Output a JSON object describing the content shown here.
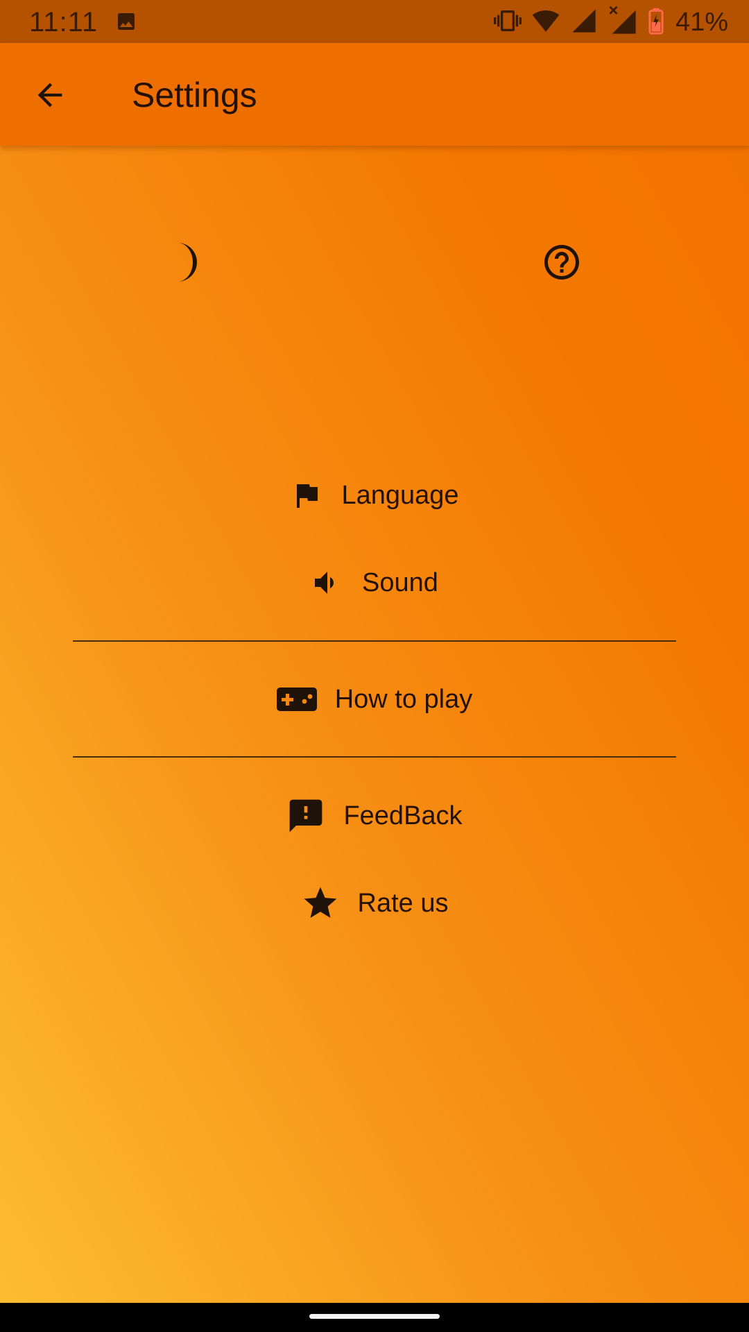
{
  "status_bar": {
    "time": "11:11",
    "battery": "41%",
    "icons": [
      "photo-icon",
      "vibrate-icon",
      "wifi-icon",
      "signal-icon",
      "signal-no-data-icon",
      "battery-charging-icon"
    ]
  },
  "app_bar": {
    "title": "Settings",
    "back_icon": "arrow-back-icon"
  },
  "quick_actions": {
    "theme_icon": "moon-icon",
    "help_icon": "help-circle-icon"
  },
  "menu": {
    "items": [
      {
        "label": "Language",
        "icon": "flag-icon"
      },
      {
        "label": "Sound",
        "icon": "speaker-icon"
      },
      {
        "label": "How to play",
        "icon": "gamepad-icon"
      },
      {
        "label": "FeedBack",
        "icon": "feedback-icon"
      },
      {
        "label": "Rate us",
        "icon": "star-icon"
      }
    ]
  },
  "colors": {
    "status_bar": "#b45200",
    "app_bar": "#ee6f00",
    "gradient_top": "#f27200",
    "gradient_bottom": "#fdbe31",
    "text": "#231107"
  }
}
